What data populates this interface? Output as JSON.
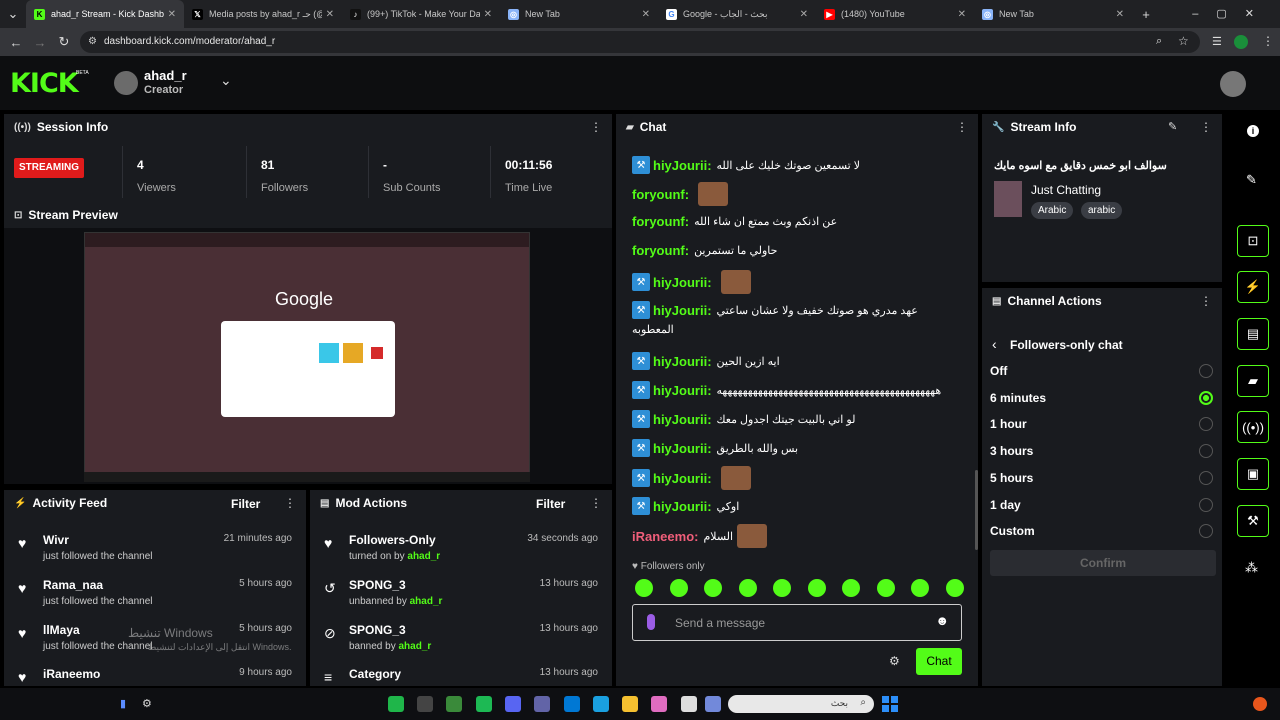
{
  "tabs": [
    {
      "title": "ahad_r Stream - Kick Dashboard",
      "icon": "kick-icon",
      "active": true
    },
    {
      "title": "Media posts by ahad_r حـ (@sh",
      "icon": "x-icon"
    },
    {
      "title": "(99+) TikTok - Make Your Day",
      "icon": "tiktok-icon"
    },
    {
      "title": "New Tab",
      "icon": "chrome-icon"
    },
    {
      "title": "Google - بحث - الجاب",
      "icon": "google-icon"
    },
    {
      "title": "(1480) YouTube",
      "icon": "youtube-icon"
    },
    {
      "title": "New Tab",
      "icon": "chrome-icon"
    }
  ],
  "url": "dashboard.kick.com/moderator/ahad_r",
  "header": {
    "logo": "KICK",
    "beta": "BETA",
    "username": "ahad_r",
    "role": "Creator"
  },
  "session": {
    "title": "Session Info",
    "status": "STREAMING",
    "stats": [
      {
        "value": "4",
        "label": "Viewers"
      },
      {
        "value": "81",
        "label": "Followers"
      },
      {
        "value": "-",
        "label": "Sub Counts"
      },
      {
        "value": "00:11:56",
        "label": "Time Live"
      }
    ]
  },
  "preview": {
    "title": "Stream Preview",
    "google": "Google"
  },
  "activity": {
    "title": "Activity Feed",
    "filter": "Filter",
    "items": [
      {
        "name": "Wivr",
        "sub": "just followed the channel",
        "time": "21 minutes ago"
      },
      {
        "name": "Rama_naa",
        "sub": "just followed the channel",
        "time": "5 hours ago"
      },
      {
        "name": "llMaya",
        "sub": "just followed the channel",
        "time": "5 hours ago"
      },
      {
        "name": "iRaneemo",
        "sub": "",
        "time": "9 hours ago"
      }
    ]
  },
  "mod": {
    "title": "Mod Actions",
    "filter": "Filter",
    "items": [
      {
        "name": "Followers-Only",
        "sub": "turned on by",
        "by": "ahad_r",
        "time": "34 seconds ago"
      },
      {
        "name": "SPONG_3",
        "sub": "unbanned by",
        "by": "ahad_r",
        "time": "13 hours ago"
      },
      {
        "name": "SPONG_3",
        "sub": "banned by",
        "by": "ahad_r",
        "time": "13 hours ago"
      },
      {
        "name": "Category",
        "sub": "",
        "by": "",
        "time": "13 hours ago"
      }
    ]
  },
  "chat": {
    "title": "Chat",
    "messages": [
      {
        "user": "hiyJourii",
        "badge": true,
        "text": "لا تسمعين صوتك خليك على الله",
        "color": "#53fc18"
      },
      {
        "user": "foryounf",
        "badge": false,
        "text": "",
        "emote": true,
        "color": "#53fc18"
      },
      {
        "user": "foryounf",
        "badge": false,
        "text": "عن اذنكم وبث ممتع ان شاء الله",
        "color": "#53fc18"
      },
      {
        "user": "foryounf",
        "badge": false,
        "text": "حاولي ما تستمرين",
        "color": "#53fc18"
      },
      {
        "user": "hiyJourii",
        "badge": true,
        "text": "",
        "emote": true,
        "color": "#53fc18"
      },
      {
        "user": "hiyJourii",
        "badge": true,
        "text": "عهد مدري هو صوتك خفيف ولا عشان ساعتي",
        "text2": "المعطوبه",
        "color": "#53fc18"
      },
      {
        "user": "hiyJourii",
        "badge": true,
        "text": "ايه ازين الحين",
        "color": "#53fc18"
      },
      {
        "user": "hiyJourii",
        "badge": true,
        "text": "هههههههههههههههههههههههههههههههههههههههههههه",
        "color": "#53fc18"
      },
      {
        "user": "hiyJourii",
        "badge": true,
        "text": "لو اني بالبيت جيتك اجدول معك",
        "color": "#53fc18"
      },
      {
        "user": "hiyJourii",
        "badge": true,
        "text": "بس والله بالطريق",
        "color": "#53fc18"
      },
      {
        "user": "hiyJourii",
        "badge": true,
        "text": "",
        "emote": true,
        "color": "#53fc18"
      },
      {
        "user": "hiyJourii",
        "badge": true,
        "text": "اوكي",
        "color": "#53fc18"
      },
      {
        "user": "iRaneemo",
        "badge": false,
        "text": "السلام",
        "emote": true,
        "color": "#f05e7a"
      }
    ],
    "followers_only": "Followers only",
    "placeholder": "Send a message",
    "send": "Chat"
  },
  "streaminfo": {
    "title": "Stream Info",
    "stream_title": "سوالف ابو خمس دقايق مع اسوه مايك",
    "category": "Just Chatting",
    "tags": [
      "Arabic",
      "arabic"
    ]
  },
  "channel": {
    "title": "Channel Actions",
    "subtitle": "Followers-only chat",
    "options": [
      "Off",
      "6 minutes",
      "1 hour",
      "3 hours",
      "5 hours",
      "1 day",
      "Custom"
    ],
    "selected": "6 minutes",
    "confirm": "Confirm"
  },
  "watermark": {
    "line1": "تنشيط Windows",
    "line2": "انتقل إلى الإعدادات لتنشيط Windows."
  },
  "taskbar": {
    "search": "بحث"
  }
}
